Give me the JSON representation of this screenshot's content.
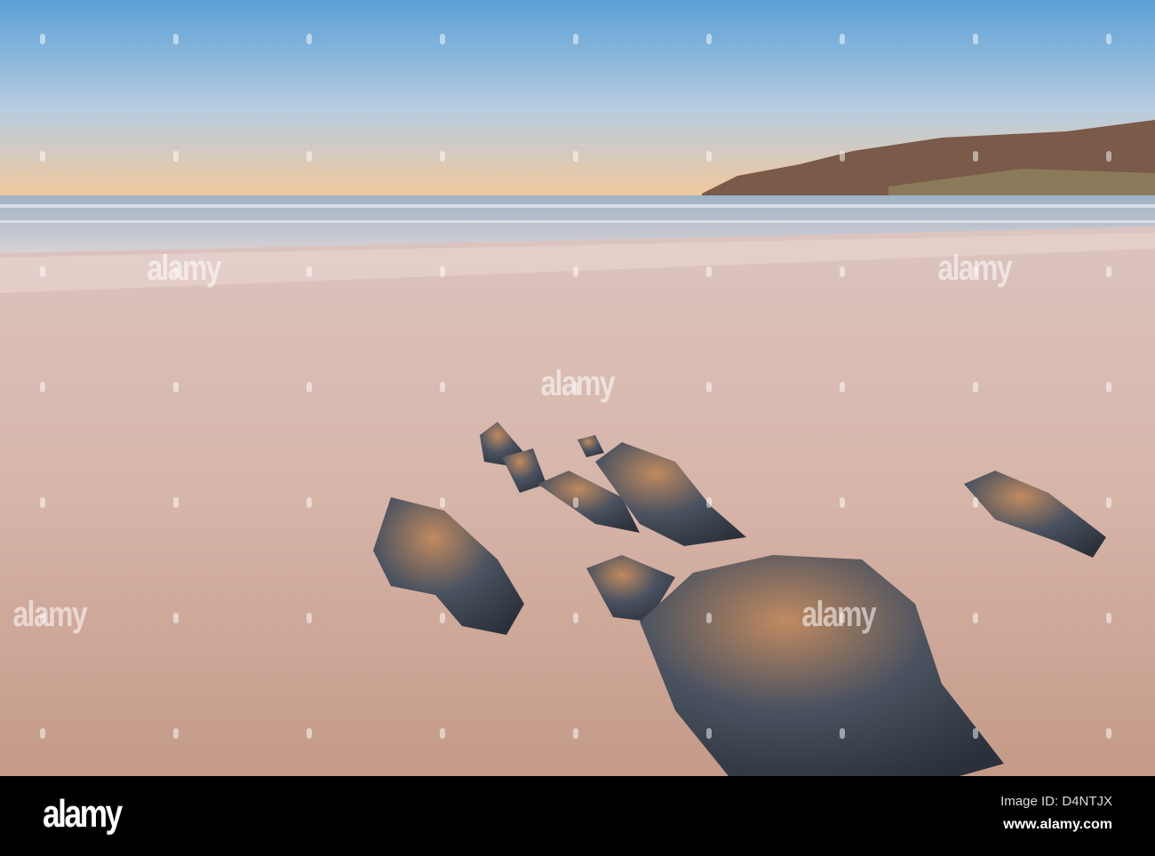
{
  "watermark": "alamy",
  "footer": {
    "logo": "alamy",
    "image_id": "Image ID: D4NTJX",
    "url": "www.alamy.com"
  }
}
